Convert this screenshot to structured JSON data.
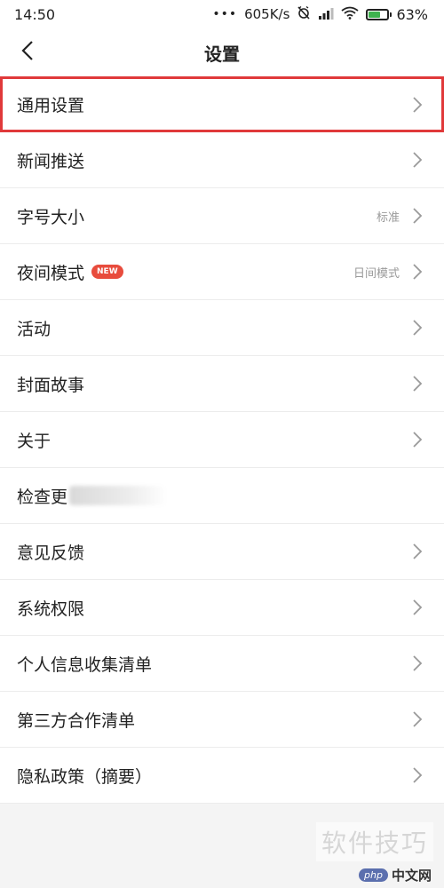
{
  "status": {
    "time": "14:50",
    "dots": "•••",
    "speed": "605K/s",
    "battery_percent": "63%",
    "battery_level": 0.63,
    "icons": [
      "alarm-off-icon",
      "signal-icon",
      "wifi-icon",
      "battery-charging-icon"
    ],
    "battery_color": "#3fb34f"
  },
  "header": {
    "title": "设置",
    "back_icon": "chevron-left-icon"
  },
  "accent_color": "#e0393a",
  "items": [
    {
      "label": "通用设置",
      "value": "",
      "badge": "",
      "chevron": true,
      "highlighted": true
    },
    {
      "label": "新闻推送",
      "value": "",
      "badge": "",
      "chevron": true
    },
    {
      "label": "字号大小",
      "value": "标准",
      "badge": "",
      "chevron": true
    },
    {
      "label": "夜间模式",
      "value": "日间模式",
      "badge": "NEW",
      "chevron": true
    },
    {
      "label": "活动",
      "value": "",
      "badge": "",
      "chevron": true
    },
    {
      "label": "封面故事",
      "value": "",
      "badge": "",
      "chevron": true
    },
    {
      "label": "关于",
      "value": "",
      "badge": "",
      "chevron": true
    },
    {
      "label": "检查更",
      "value": "",
      "badge": "",
      "chevron": false,
      "obscured": true
    },
    {
      "label": "意见反馈",
      "value": "",
      "badge": "",
      "chevron": true
    },
    {
      "label": "系统权限",
      "value": "",
      "badge": "",
      "chevron": true
    },
    {
      "label": "个人信息收集清单",
      "value": "",
      "badge": "",
      "chevron": true
    },
    {
      "label": "第三方合作清单",
      "value": "",
      "badge": "",
      "chevron": true
    },
    {
      "label": "隐私政策（摘要）",
      "value": "",
      "badge": "",
      "chevron": true
    }
  ],
  "watermark": {
    "text": "软件技巧",
    "logo": "php",
    "site": "中文网"
  }
}
